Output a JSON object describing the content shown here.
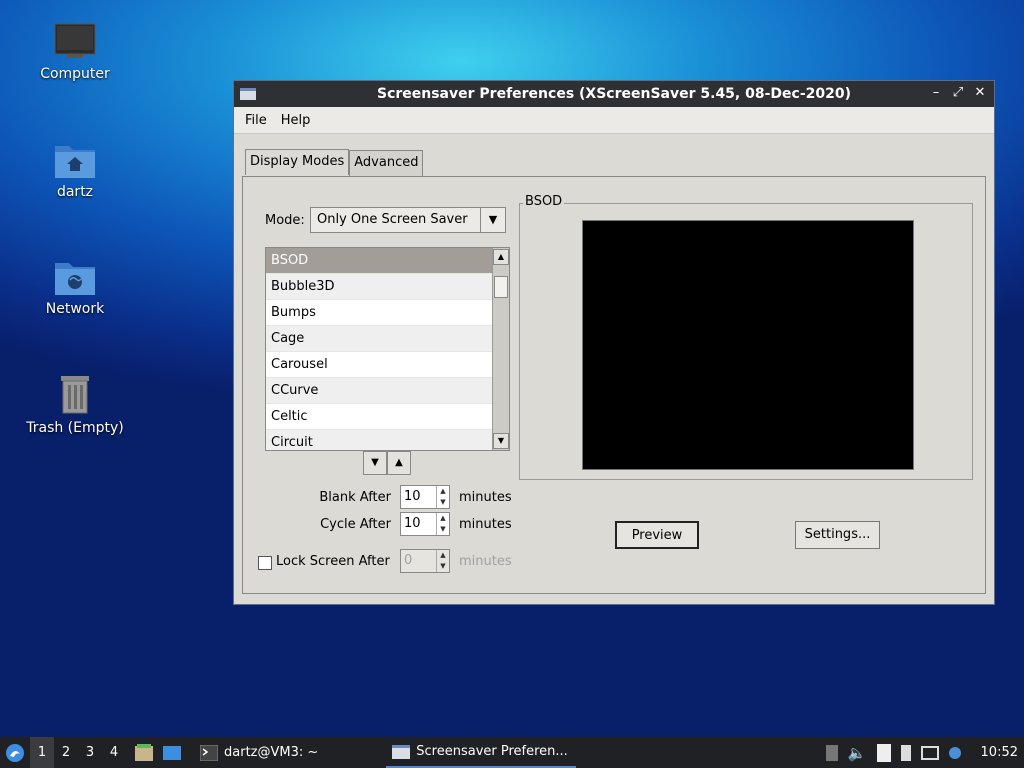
{
  "desktop": {
    "icons": [
      {
        "label": "Computer"
      },
      {
        "label": "dartz"
      },
      {
        "label": "Network"
      },
      {
        "label": "Trash (Empty)"
      }
    ]
  },
  "window": {
    "title": "Screensaver Preferences  (XScreenSaver 5.45, 08-Dec-2020)",
    "menu": [
      "File",
      "Help"
    ],
    "tabs": [
      "Display Modes",
      "Advanced"
    ],
    "mode": {
      "label": "Mode:",
      "value": "Only One Screen Saver"
    },
    "savers": [
      "BSOD",
      "Bubble3D",
      "Bumps",
      "Cage",
      "Carousel",
      "CCurve",
      "Celtic",
      "Circuit"
    ],
    "selected_saver": "BSOD",
    "blank_after": {
      "label": "Blank After",
      "value": "10",
      "units": "minutes"
    },
    "cycle_after": {
      "label": "Cycle After",
      "value": "10",
      "units": "minutes"
    },
    "lock_screen": {
      "label": "Lock Screen After",
      "value": "0",
      "units": "minutes",
      "checked": false
    },
    "preview_frame_label": "BSOD",
    "preview_button": "Preview",
    "settings_button": "Settings..."
  },
  "taskbar": {
    "workspaces": [
      "1",
      "2",
      "3",
      "4"
    ],
    "terminal_task": "dartz@VM3: ~",
    "window_task": "Screensaver Preferen...",
    "clock": "10:52"
  },
  "colors": {
    "selection": "#a29d96",
    "window_bg": "#dcdad5",
    "titlebar": "#2e3034",
    "taskbar": "#202124"
  }
}
